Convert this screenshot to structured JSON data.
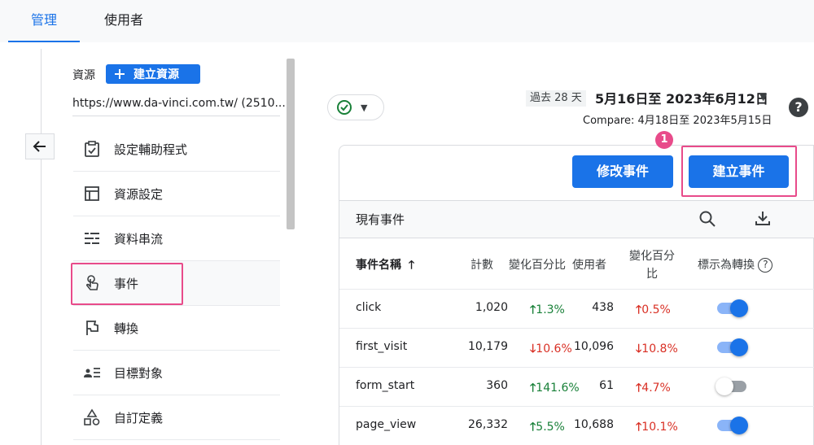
{
  "tabs": [
    {
      "label": "管理",
      "active": true
    },
    {
      "label": "使用者",
      "active": false
    }
  ],
  "sidebar": {
    "resource_label": "資源",
    "create_resource_label": "建立資源",
    "url": "https://www.da-vinci.com.tw/ (2510...",
    "items": [
      {
        "label": "設定輔助程式",
        "icon": "clipboard-check-icon"
      },
      {
        "label": "資源設定",
        "icon": "layout-icon"
      },
      {
        "label": "資料串流",
        "icon": "data-stream-icon"
      },
      {
        "label": "事件",
        "icon": "touch-icon",
        "selected": true
      },
      {
        "label": "轉換",
        "icon": "flag-icon"
      },
      {
        "label": "目標對象",
        "icon": "audience-icon"
      },
      {
        "label": "自訂定義",
        "icon": "shapes-icon"
      }
    ]
  },
  "date": {
    "badge": "過去 28 天",
    "range": "5月16日至 2023年6月12日",
    "compare": "Compare: 4月18日至 2023年5月15日"
  },
  "actions": {
    "modify_label": "修改事件",
    "create_label": "建立事件",
    "step_badge": "1"
  },
  "events": {
    "title": "現有事件",
    "columns": {
      "name": "事件名稱",
      "count": "計數",
      "count_change": "變化百分比",
      "users": "使用者",
      "users_change_line1": "變化百分",
      "users_change_line2": "比",
      "mark_conversion": "標示為轉換"
    },
    "rows": [
      {
        "name": "click",
        "count": "1,020",
        "count_change": "1.3%",
        "count_dir": "up",
        "users": "438",
        "users_change": "0.5%",
        "users_dir": "up",
        "conversion": true
      },
      {
        "name": "first_visit",
        "count": "10,179",
        "count_change": "10.6%",
        "count_dir": "down",
        "users": "10,096",
        "users_change": "10.8%",
        "users_dir": "down",
        "conversion": true
      },
      {
        "name": "form_start",
        "count": "360",
        "count_change": "141.6%",
        "count_dir": "up",
        "users": "61",
        "users_change": "4.7%",
        "users_dir": "up",
        "conversion": false
      },
      {
        "name": "page_view",
        "count": "26,332",
        "count_change": "5.5%",
        "count_dir": "up",
        "users": "10,688",
        "users_change": "10.1%",
        "users_dir": "up",
        "conversion": true
      }
    ]
  },
  "colors": {
    "accent": "#1a73e8",
    "highlight": "#e84b8a",
    "up_count": "#188038",
    "up_users": "#d93025",
    "down": "#d93025"
  }
}
